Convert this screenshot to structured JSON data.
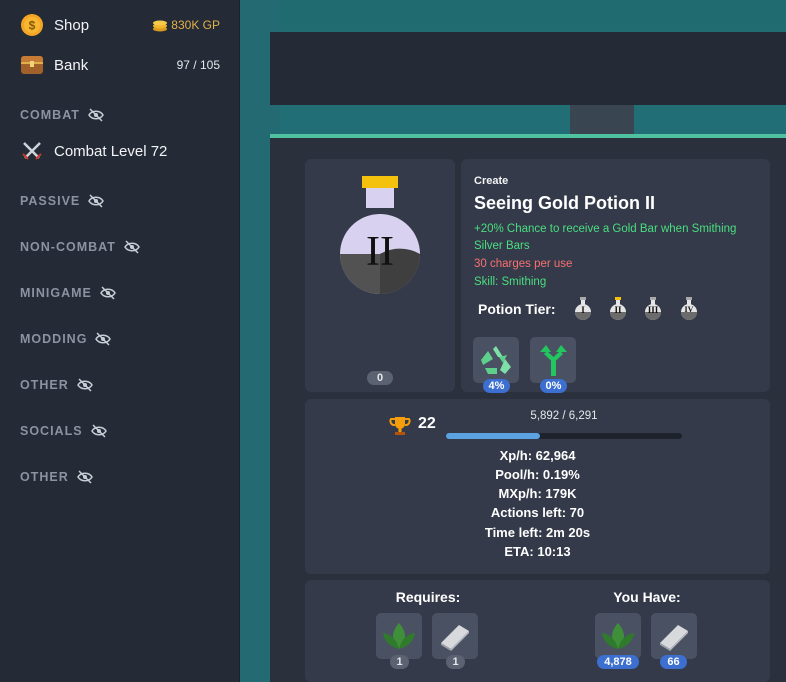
{
  "sidebar": {
    "shop": {
      "label": "Shop",
      "gp": "830K GP"
    },
    "bank": {
      "label": "Bank",
      "count": "97 / 105"
    },
    "combat_level": "Combat Level 72",
    "categories": [
      "COMBAT",
      "PASSIVE",
      "NON-COMBAT",
      "MINIGAME",
      "MODDING",
      "OTHER",
      "SOCIALS",
      "OTHER"
    ]
  },
  "recipe": {
    "create_label": "Create",
    "name": "Seeing Gold Potion II",
    "effect_line1": "+20% Chance to receive a Gold Bar when Smithing",
    "effect_line2": "Silver Bars",
    "charges": "30 charges per use",
    "skill": "Skill: Smithing",
    "potion_numeral": "II",
    "owned_count": "0",
    "tier_label": "Potion Tier:",
    "tiers": [
      "I",
      "II",
      "III",
      "IV"
    ],
    "preserve_chance": "4%",
    "double_chance": "0%"
  },
  "stats": {
    "mastery_level": "22",
    "mastery_xp": "5,892 / 6,291",
    "mastery_progress": 0.4,
    "xp_per_hour": "Xp/h: 62,964",
    "pool_per_hour": "Pool/h: 0.19%",
    "mxp_per_hour": "MXp/h: 179K",
    "actions_left": "Actions left: 70",
    "time_left": "Time left: 2m 20s",
    "eta": "ETA: 10:13"
  },
  "requirements": {
    "requires_label": "Requires:",
    "you_have_label": "You Have:",
    "required": [
      {
        "icon": "herb-icon",
        "qty": "1"
      },
      {
        "icon": "silver-bar-icon",
        "qty": "1"
      }
    ],
    "owned": [
      {
        "icon": "herb-icon",
        "qty": "4,878"
      },
      {
        "icon": "silver-bar-icon",
        "qty": "66"
      }
    ]
  },
  "colors": {
    "accent": "#4fc3a1",
    "gold": "#e0b14a",
    "green_text": "#4ade80",
    "red_text": "#f87171",
    "badge_blue": "#3c6fd0"
  }
}
